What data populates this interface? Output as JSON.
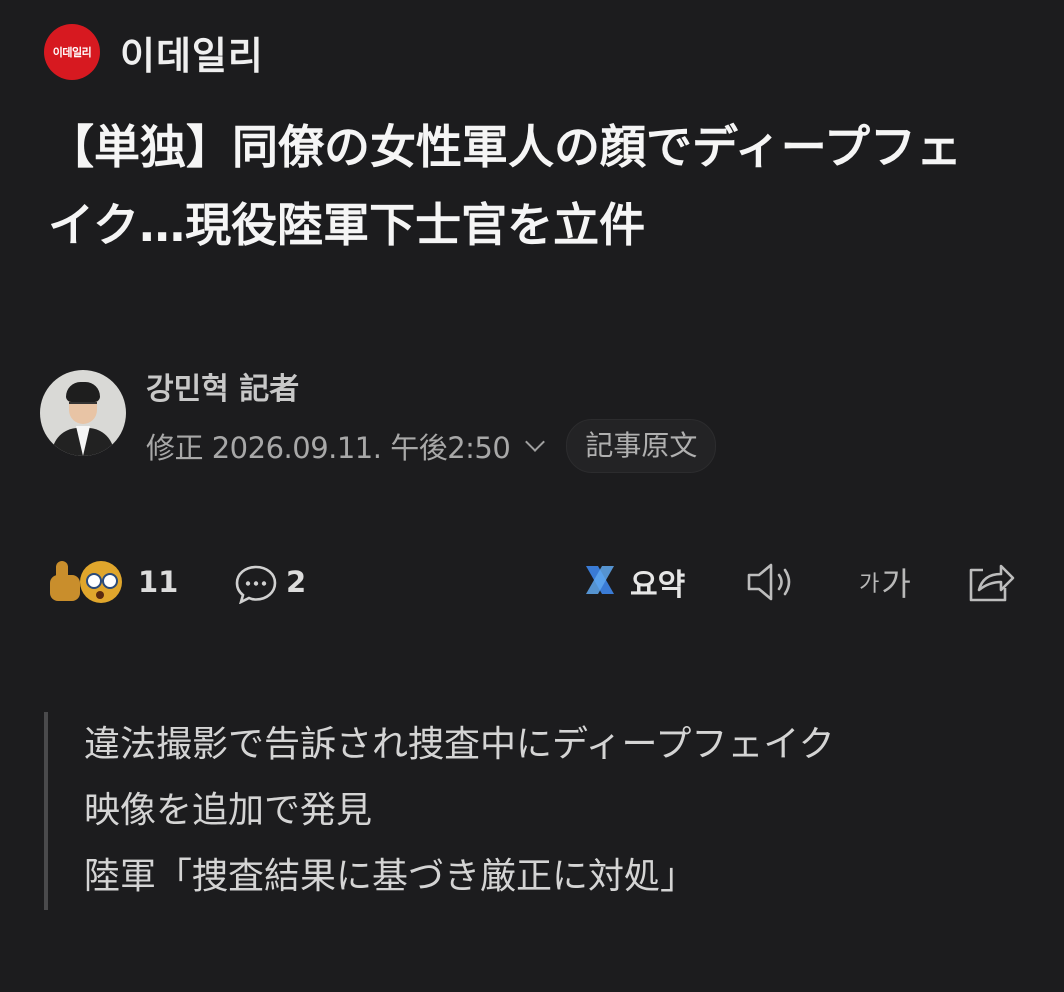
{
  "publisher": {
    "logo_text": "이데일리",
    "name": "이데일리",
    "brand_color": "#d71920"
  },
  "headline": "【単独】同僚の女性軍人の顔でディープフェイク…現役陸軍下士官を立件",
  "author": {
    "name": "강민혁 記者",
    "timestamp": "修正 2026.09.11. 午後2:50",
    "original_button": "記事原文"
  },
  "actions": {
    "reaction_count": "11",
    "comment_count": "2",
    "summary_label": "요약",
    "font_small": "가",
    "font_big": "가",
    "icons": [
      "thumbs-up-icon",
      "surprised-emoji-icon",
      "comment-icon",
      "summary-icon",
      "speaker-icon",
      "font-size-icon",
      "share-icon"
    ]
  },
  "summary": {
    "lines": [
      "違法撮影で告訴され捜査中にディープフェイク",
      "映像を追加で発見",
      "陸軍「捜査結果に基づき厳正に対処」"
    ]
  }
}
